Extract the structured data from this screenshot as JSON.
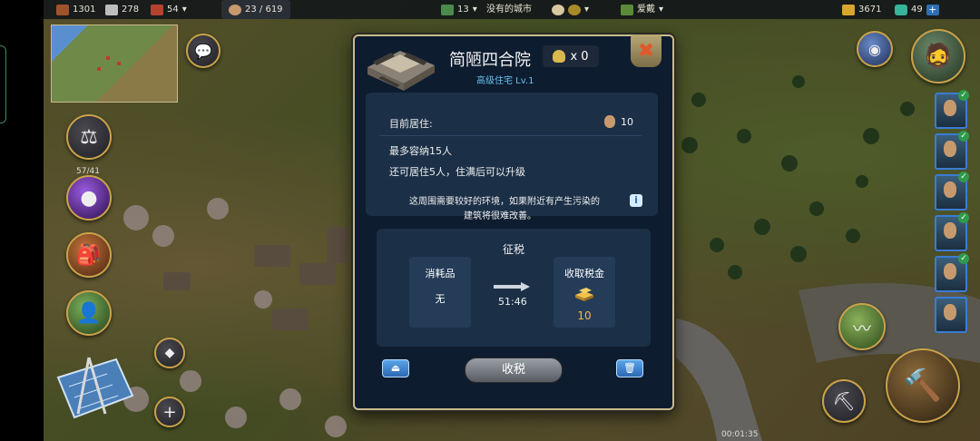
{
  "topbar": {
    "wood": "1301",
    "stone": "278",
    "brick": "54",
    "population": "23 / 619",
    "level": "13",
    "city_filter": "没有的城市",
    "leader_name": "爱戴",
    "gold": "3671",
    "gems": "49",
    "plus": "+"
  },
  "left_panel": {
    "energy_label": "57/41"
  },
  "dialog": {
    "title": "简陋四合院",
    "badge_count": "x 0",
    "subtitle": "高级住宅 Lv.1",
    "close": "✖",
    "current_residents_label": "目前居住:",
    "current_residents_value": "10",
    "capacity_text": "最多容纳15人",
    "remaining_text": "还可居住5人，住满后可以升级",
    "environment_note_line1": "这周围需要较好的环境，如果附近有产生污染的",
    "environment_note_line2": "建筑将很难改善。",
    "info_icon": "i",
    "tax": {
      "heading": "征税",
      "consume_label": "消耗品",
      "consume_value": "无",
      "timer": "51:46",
      "collect_label": "收取税金",
      "collect_value": "10"
    },
    "collect_button": "收税"
  },
  "bottom": {
    "clock": "00:01:35"
  },
  "colors": {
    "dialog_bg": "#0e1c2f",
    "card_bg": "#1b3047",
    "accent_blue": "#67c0ee",
    "gold_text": "#f0b94a"
  }
}
